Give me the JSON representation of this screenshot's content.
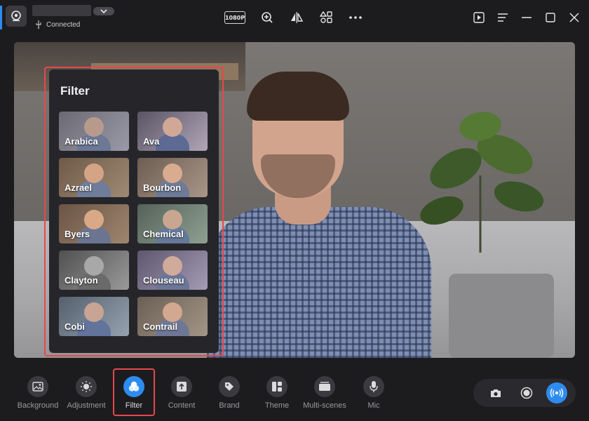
{
  "header": {
    "connection_status": "Connected",
    "resolution": "1080P",
    "icons": [
      "camera-device-icon",
      "usb-icon",
      "zoom-in-icon",
      "mirror-icon",
      "layout-icon",
      "more-icon",
      "play-icon",
      "menu-icon",
      "minimize-icon",
      "maximize-icon",
      "close-icon"
    ]
  },
  "filter_panel": {
    "title": "Filter",
    "items": [
      {
        "label": "Arabica"
      },
      {
        "label": "Ava"
      },
      {
        "label": "Azrael"
      },
      {
        "label": "Bourbon"
      },
      {
        "label": "Byers"
      },
      {
        "label": "Chemical"
      },
      {
        "label": "Clayton"
      },
      {
        "label": "Clouseau"
      },
      {
        "label": "Cobi"
      },
      {
        "label": "Contrail"
      }
    ]
  },
  "toolbar": {
    "active": "Filter",
    "items": [
      {
        "label": "Background",
        "icon": "image-icon"
      },
      {
        "label": "Adjustment",
        "icon": "brightness-icon"
      },
      {
        "label": "Filter",
        "icon": "filter-icon"
      },
      {
        "label": "Content",
        "icon": "upload-icon"
      },
      {
        "label": "Brand",
        "icon": "tag-icon"
      },
      {
        "label": "Theme",
        "icon": "theme-icon"
      },
      {
        "label": "Multi-scenes",
        "icon": "scenes-icon"
      },
      {
        "label": "Mic",
        "icon": "mic-icon"
      }
    ]
  },
  "actions": [
    "snapshot-icon",
    "record-icon",
    "live-icon"
  ],
  "colors": {
    "accent": "#2d8cf0",
    "highlight": "#e5484d",
    "background": "#1c1c1f"
  }
}
